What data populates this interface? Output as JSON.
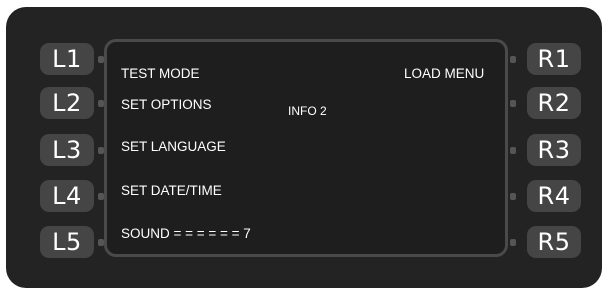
{
  "left_keys": [
    "L1",
    "L2",
    "L3",
    "L4",
    "L5"
  ],
  "right_keys": [
    "R1",
    "R2",
    "R3",
    "R4",
    "R5"
  ],
  "screen": {
    "left_items": [
      "TEST MODE",
      "SET OPTIONS",
      "SET LANGUAGE",
      "SET DATE/TIME",
      "SOUND = = = = = = 7"
    ],
    "right_item": "LOAD MENU",
    "info": "INFO 2"
  }
}
